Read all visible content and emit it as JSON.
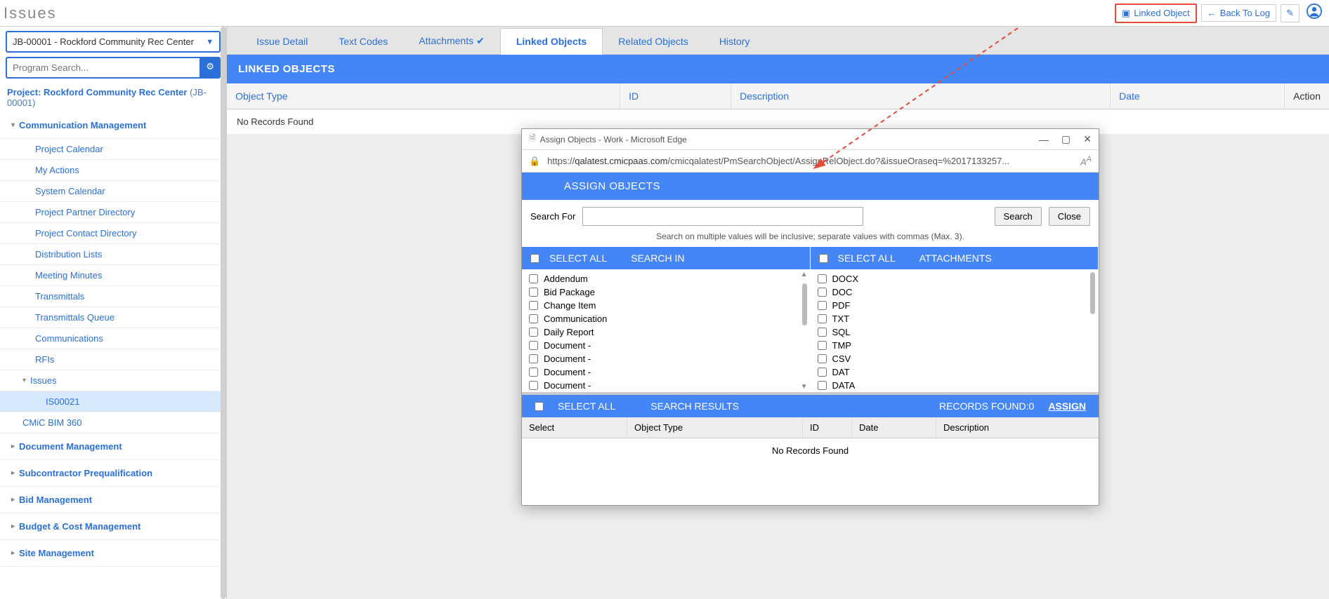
{
  "page_title": "Issues",
  "header": {
    "linked_object_btn": "Linked Object",
    "back_to_log_btn": "Back To Log"
  },
  "sidebar": {
    "job_selected": "JB-00001 - Rockford Community Rec Center",
    "search_placeholder": "Program Search...",
    "project_label": "Project: Rockford Community Rec Center",
    "project_code": "(JB-00001)",
    "group_comm": "Communication Management",
    "items": [
      "Project Calendar",
      "My Actions",
      "System Calendar",
      "Project Partner Directory",
      "Project Contact Directory",
      "Distribution Lists",
      "Meeting Minutes",
      "Transmittals",
      "Transmittals Queue",
      "Communications",
      "RFIs"
    ],
    "issues_label": "Issues",
    "selected_issue": "IS00021",
    "cmic_item": "CMiC BIM 360",
    "groups": [
      "Document Management",
      "Subcontractor Prequalification",
      "Bid Management",
      "Budget & Cost Management",
      "Site Management"
    ]
  },
  "tabs": {
    "issue_detail": "Issue Detail",
    "text_codes": "Text Codes",
    "attachments": "Attachments",
    "linked_objects": "Linked Objects",
    "related_objects": "Related Objects",
    "history": "History"
  },
  "section_title": "LINKED OBJECTS",
  "table": {
    "cols": [
      "Object Type",
      "ID",
      "Description",
      "Date",
      "Action"
    ],
    "empty": "No Records Found"
  },
  "dialog": {
    "win_title": "Assign Objects - Work - Microsoft Edge",
    "url_prefix": "https://",
    "url_host": "qalatest.cmicpaas.com",
    "url_path": "/cmicqalatest/PmSearchObject/AssignRelObject.do?&issueOraseq=%2017133257...",
    "head": "ASSIGN OBJECTS",
    "search_for_label": "Search For",
    "search_btn": "Search",
    "close_btn": "Close",
    "hint": "Search on multiple values will be inclusive; separate values with commas (Max. 3).",
    "select_all": "SELECT ALL",
    "search_in": "SEARCH IN",
    "attachments": "ATTACHMENTS",
    "search_in_items": [
      "Addendum",
      "Bid Package",
      "Change Item",
      "Communication",
      "Daily Report",
      "Document -",
      "Document -",
      "Document -",
      "Document -"
    ],
    "attachment_items": [
      "DOCX",
      "DOC",
      "PDF",
      "TXT",
      "SQL",
      "TMP",
      "CSV",
      "DAT",
      "DATA"
    ],
    "search_results": "SEARCH RESULTS",
    "records_found": "RECORDS FOUND:0",
    "assign": "ASSIGN",
    "res_cols": [
      "Select",
      "Object Type",
      "ID",
      "Date",
      "Description"
    ],
    "res_empty": "No Records Found"
  }
}
